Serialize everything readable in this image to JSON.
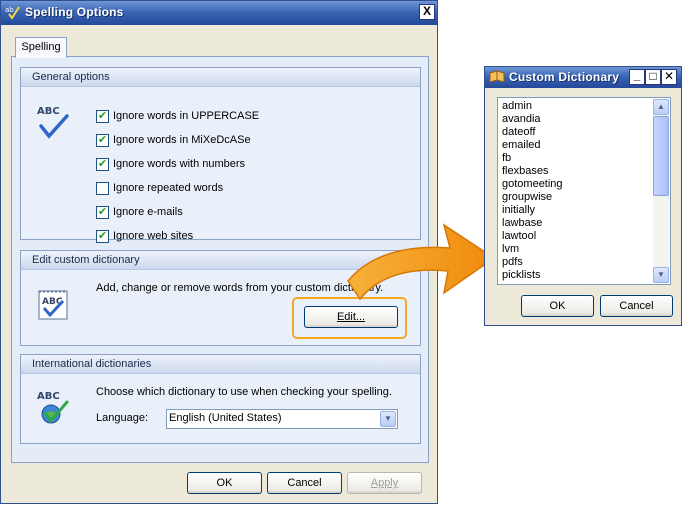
{
  "spelling_options": {
    "title": "Spelling Options",
    "close_glyph": "X",
    "tab": "Spelling",
    "general": {
      "header": "General options",
      "icon_text": "ABC",
      "options": [
        {
          "label": "Ignore words in UPPERCASE",
          "checked": true
        },
        {
          "label": "Ignore words in MiXeDcASe",
          "checked": true
        },
        {
          "label": "Ignore words with numbers",
          "checked": true
        },
        {
          "label": "Ignore repeated words",
          "checked": false
        },
        {
          "label": "Ignore e-mails",
          "checked": true
        },
        {
          "label": "Ignore web sites",
          "checked": true
        }
      ]
    },
    "custom": {
      "header": "Edit custom dictionary",
      "icon_text": "ABC",
      "description": "Add, change or remove words from your custom dictionary.",
      "edit_button": "Edit..."
    },
    "international": {
      "header": "International dictionaries",
      "icon_text": "ABC",
      "description": "Choose which dictionary to use when checking your spelling.",
      "language_label": "Language:",
      "language_value": "English (United States)"
    },
    "buttons": {
      "ok": "OK",
      "cancel": "Cancel",
      "apply": "Apply"
    }
  },
  "custom_dictionary": {
    "title": "Custom Dictionary",
    "words": [
      "admin",
      "avandia",
      "dateoff",
      "emailed",
      "fb",
      "flexbases",
      "gotomeeting",
      "groupwise",
      "initially",
      "lawbase",
      "lawtool",
      "lvm",
      "pdfs",
      "picklists"
    ],
    "buttons": {
      "ok": "OK",
      "cancel": "Cancel"
    }
  },
  "colors": {
    "accent_orange": "#f5a623",
    "titlebar_blue": "#3b66b4",
    "check_green": "#21a121"
  }
}
